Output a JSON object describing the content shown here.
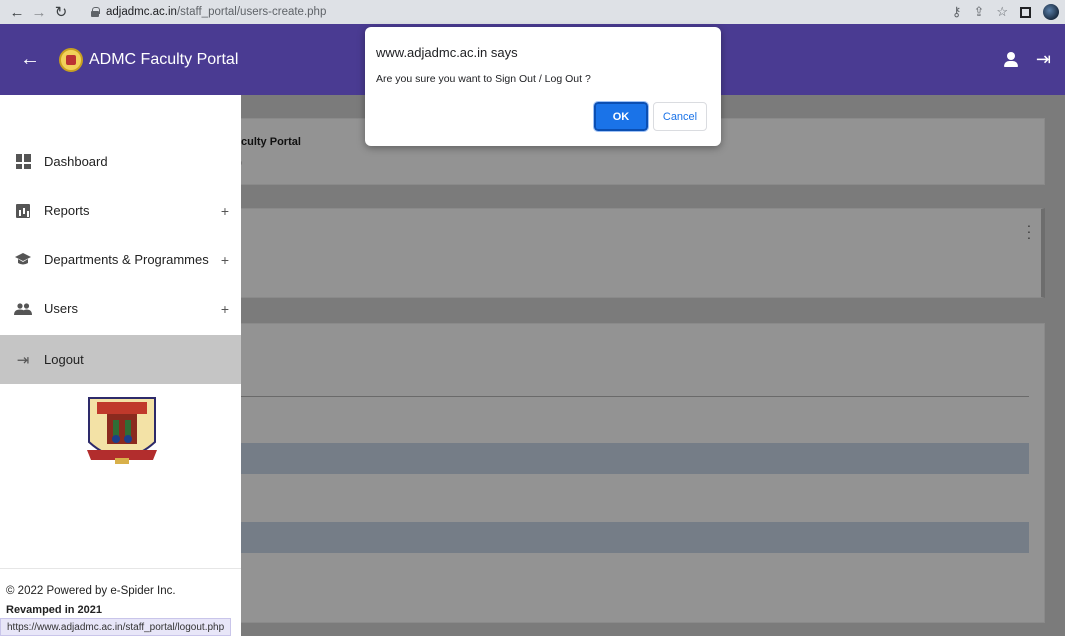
{
  "browser": {
    "url_host": "adjadmc.ac.in",
    "url_path": "/staff_portal/users-create.php",
    "status_url": "https://www.adjadmc.ac.in/staff_portal/logout.php"
  },
  "header": {
    "brand": "ADMC Faculty Portal"
  },
  "background": {
    "crumb_title": "culty Portal",
    "crumb_sub": ")"
  },
  "sidebar": {
    "items": [
      {
        "label": "Dashboard"
      },
      {
        "label": "Reports",
        "expand": "+"
      },
      {
        "label": "Departments & Programmes",
        "expand": "+"
      },
      {
        "label": "Users",
        "expand": "+"
      },
      {
        "label": "Logout"
      }
    ],
    "footer_powered": "© 2022 Powered by e-Spider Inc.",
    "footer_revamped": "Revamped in 2021"
  },
  "dialog": {
    "title": "www.adjadmc.ac.in says",
    "message": "Are you sure you want to  Sign Out / Log Out ?",
    "ok_label": "OK",
    "cancel_label": "Cancel"
  },
  "colors": {
    "appbar": "#4a3b92",
    "ok_button": "#1a73e8"
  }
}
